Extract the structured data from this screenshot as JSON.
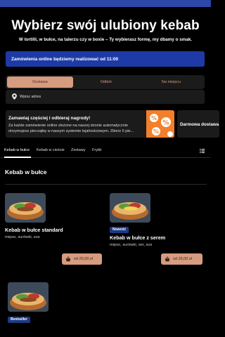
{
  "hero": {
    "title": "Wybierz swój ulubiony kebab",
    "subtitle": "W tortilli, w bułce, na talerzu czy w boxie – Ty wybierasz formę, my dbamy o smak."
  },
  "notice": {
    "text": "Zamówienia online będziemy realizować od 11:00"
  },
  "order_modes": [
    {
      "label": "Dostawa",
      "active": true
    },
    {
      "label": "Odbiór",
      "active": false
    },
    {
      "label": "Na miejscu",
      "active": false
    }
  ],
  "address": {
    "placeholder": "Wpisz adres",
    "icon": "map-pin-icon"
  },
  "promos": [
    {
      "title": "Zamawiaj częściej i odbieraj nagrody!",
      "text": "Za każde zamówienie online złożone na naszej stronie automatycznie otrzymujesz pieczątkę w naszym systemie lojalnościowym. Zbierz 5 pie...",
      "icon": "loyalty-percent-icon"
    },
    {
      "title": "Darmowa dostawa"
    }
  ],
  "categories": [
    {
      "label": "Kebab w bułce",
      "active": true
    },
    {
      "label": "Kebab w cieście",
      "active": false
    },
    {
      "label": "Zestawy",
      "active": false
    },
    {
      "label": "Frytki",
      "active": false
    }
  ],
  "section": {
    "title": "Kebab w bułce"
  },
  "products": [
    {
      "name": "Kebab w bułce standard",
      "desc": "mięso, surówki, sos",
      "price": "od 25,00 zł",
      "badge": ""
    },
    {
      "name": "Kebab w bułce z serem",
      "desc": "mięso, surówki, ser, sos",
      "price": "od 25,00 zł",
      "badge": "Nowość"
    },
    {
      "name": "",
      "desc": "",
      "price": "",
      "badge": "Bestseller"
    }
  ],
  "colors": {
    "accent": "#d59c7f",
    "brand_blue": "#1d3aa6",
    "promo_orange": "#f37f2a",
    "badge_blue": "#1c3b86"
  }
}
